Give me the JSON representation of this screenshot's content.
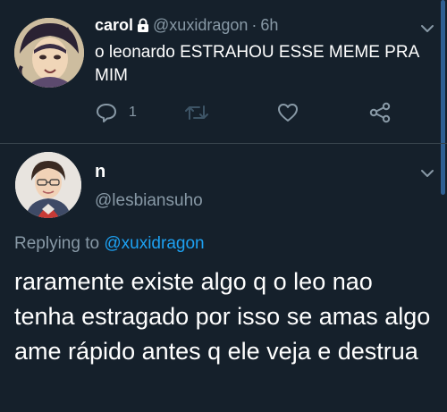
{
  "colors": {
    "background": "#15202b",
    "secondary_text": "#8899a6",
    "link": "#1da1f2",
    "divider": "#38444d"
  },
  "tweet1": {
    "name": "carol",
    "handle": "@xuxidragon",
    "dot": "·",
    "time": "6h",
    "text": "o leonardo ESTRAHOU ESSE MEME PRA MIM",
    "reply_count": "1",
    "icons": [
      "lock-icon",
      "chevron-down-icon",
      "reply-icon",
      "retweet-icon",
      "like-icon",
      "share-icon"
    ]
  },
  "tweet2": {
    "name": "n",
    "handle": "@lesbiansuho",
    "replying_prefix": "Replying to",
    "replying_to": "@xuxidragon",
    "text": "raramente existe algo q o leo nao tenha estragado por isso se amas algo ame rápido antes q ele veja e destrua",
    "icons": [
      "chevron-down-icon"
    ]
  }
}
